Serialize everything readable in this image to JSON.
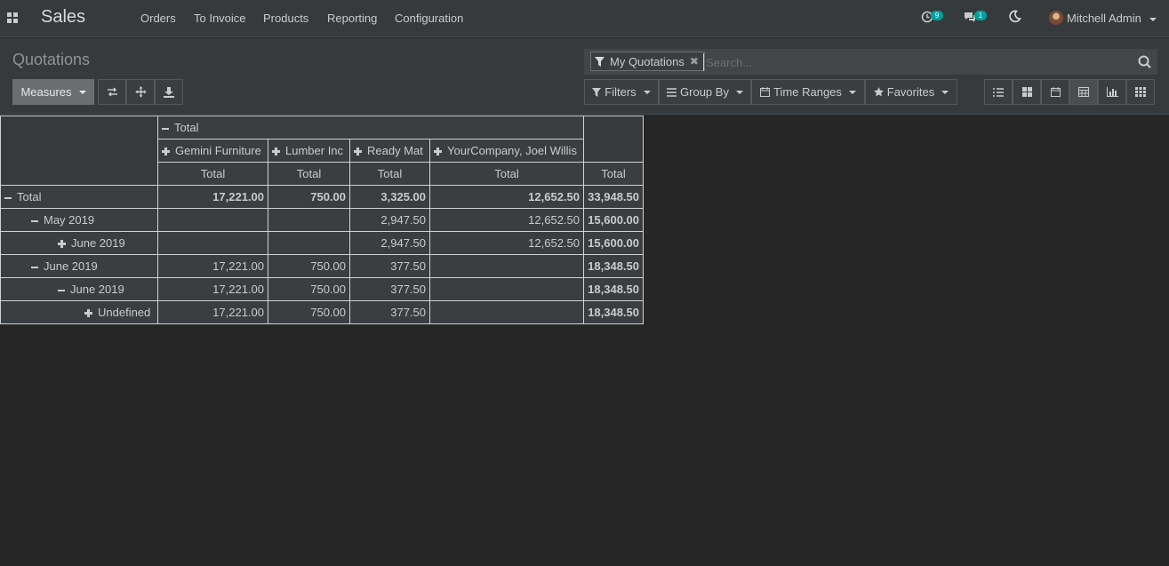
{
  "app": {
    "name": "Sales"
  },
  "menu": {
    "items": [
      "Orders",
      "To Invoice",
      "Products",
      "Reporting",
      "Configuration"
    ]
  },
  "systray": {
    "activity_count": "9",
    "messages_count": "1",
    "user_name": "Mitchell Admin"
  },
  "page": {
    "title": "Quotations"
  },
  "search": {
    "facet_label": "My Quotations",
    "placeholder": "Search..."
  },
  "toolbar": {
    "measures_label": "Measures",
    "filters_label": "Filters",
    "groupby_label": "Group By",
    "timeranges_label": "Time Ranges",
    "favorites_label": "Favorites"
  },
  "pivot": {
    "col_header_total": "Total",
    "columns": [
      "Gemini Furniture",
      "Lumber Inc",
      "Ready Mat",
      "YourCompany, Joel Willis"
    ],
    "measure_label": "Total",
    "rows": [
      {
        "label": "Total",
        "values": [
          "17,221.00",
          "750.00",
          "3,325.00",
          "12,652.50"
        ],
        "total": "33,948.50"
      },
      {
        "label": "May 2019",
        "values": [
          "",
          "",
          "2,947.50",
          "12,652.50"
        ],
        "total": "15,600.00"
      },
      {
        "label": "June 2019",
        "values": [
          "",
          "",
          "2,947.50",
          "12,652.50"
        ],
        "total": "15,600.00"
      },
      {
        "label": "June 2019",
        "values": [
          "17,221.00",
          "750.00",
          "377.50",
          ""
        ],
        "total": "18,348.50"
      },
      {
        "label": "June 2019",
        "values": [
          "17,221.00",
          "750.00",
          "377.50",
          ""
        ],
        "total": "18,348.50"
      },
      {
        "label": "Undefined",
        "values": [
          "17,221.00",
          "750.00",
          "377.50",
          ""
        ],
        "total": "18,348.50"
      }
    ]
  },
  "colors": {
    "background": "#262626",
    "panel": "#373a3c",
    "badge": "#00a09d"
  }
}
